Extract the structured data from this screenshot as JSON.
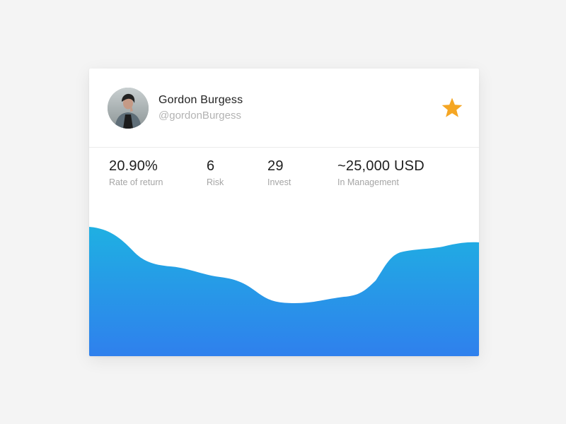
{
  "profile": {
    "name": "Gordon Burgess",
    "handle": "@gordonBurgess"
  },
  "favorite": {
    "icon": "star-icon",
    "color": "#f5a623"
  },
  "stats": [
    {
      "value": "20.90%",
      "label": "Rate of return"
    },
    {
      "value": "6",
      "label": "Risk"
    },
    {
      "value": "29",
      "label": "Invest"
    },
    {
      "value": "~25,000 USD",
      "label": "In Management"
    }
  ],
  "chart_data": {
    "type": "area",
    "gradient_top": "#1fb0e2",
    "gradient_bottom": "#2f80ed"
  }
}
